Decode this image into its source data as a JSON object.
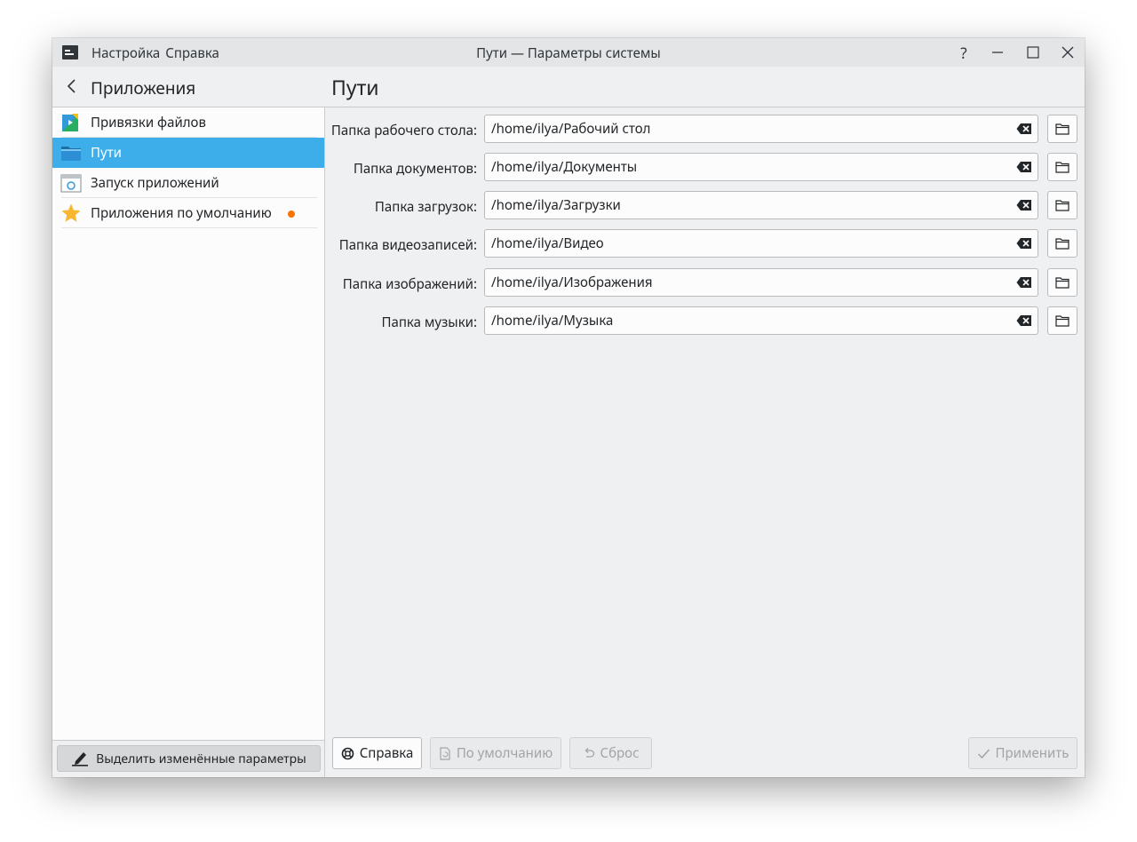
{
  "menu": [
    "Настройка",
    "Справка"
  ],
  "window_title": "Пути — Параметры системы",
  "window_buttons": {
    "help": "?",
    "minimize": "minimize",
    "maximize": "maximize",
    "close": "close"
  },
  "sidebar": {
    "title": "Приложения",
    "items": [
      {
        "label": "Привязки файлов",
        "icon": "file-associations-icon",
        "active": false
      },
      {
        "label": "Пути",
        "icon": "folder-icon",
        "active": true
      },
      {
        "label": "Запуск приложений",
        "icon": "launch-feedback-icon",
        "active": false
      },
      {
        "label": "Приложения по умолчанию",
        "icon": "star-icon",
        "active": false,
        "changed": true
      }
    ],
    "highlight_button": "Выделить изменённые параметры"
  },
  "page_title": "Пути",
  "paths": [
    {
      "label": "Папка рабочего стола:",
      "value": "/home/ilya/Рабочий стол"
    },
    {
      "label": "Папка документов:",
      "value": "/home/ilya/Документы"
    },
    {
      "label": "Папка загрузок:",
      "value": "/home/ilya/Загрузки"
    },
    {
      "label": "Папка видеозаписей:",
      "value": "/home/ilya/Видео"
    },
    {
      "label": "Папка изображений:",
      "value": "/home/ilya/Изображения"
    },
    {
      "label": "Папка музыки:",
      "value": "/home/ilya/Музыка"
    }
  ],
  "buttons": {
    "help": "Справка",
    "defaults": "По умолчанию",
    "reset": "Сброс",
    "apply": "Применить"
  },
  "colors": {
    "accent": "#3daee9",
    "changed_dot": "#f67400",
    "window_bg": "#eff0f1"
  }
}
